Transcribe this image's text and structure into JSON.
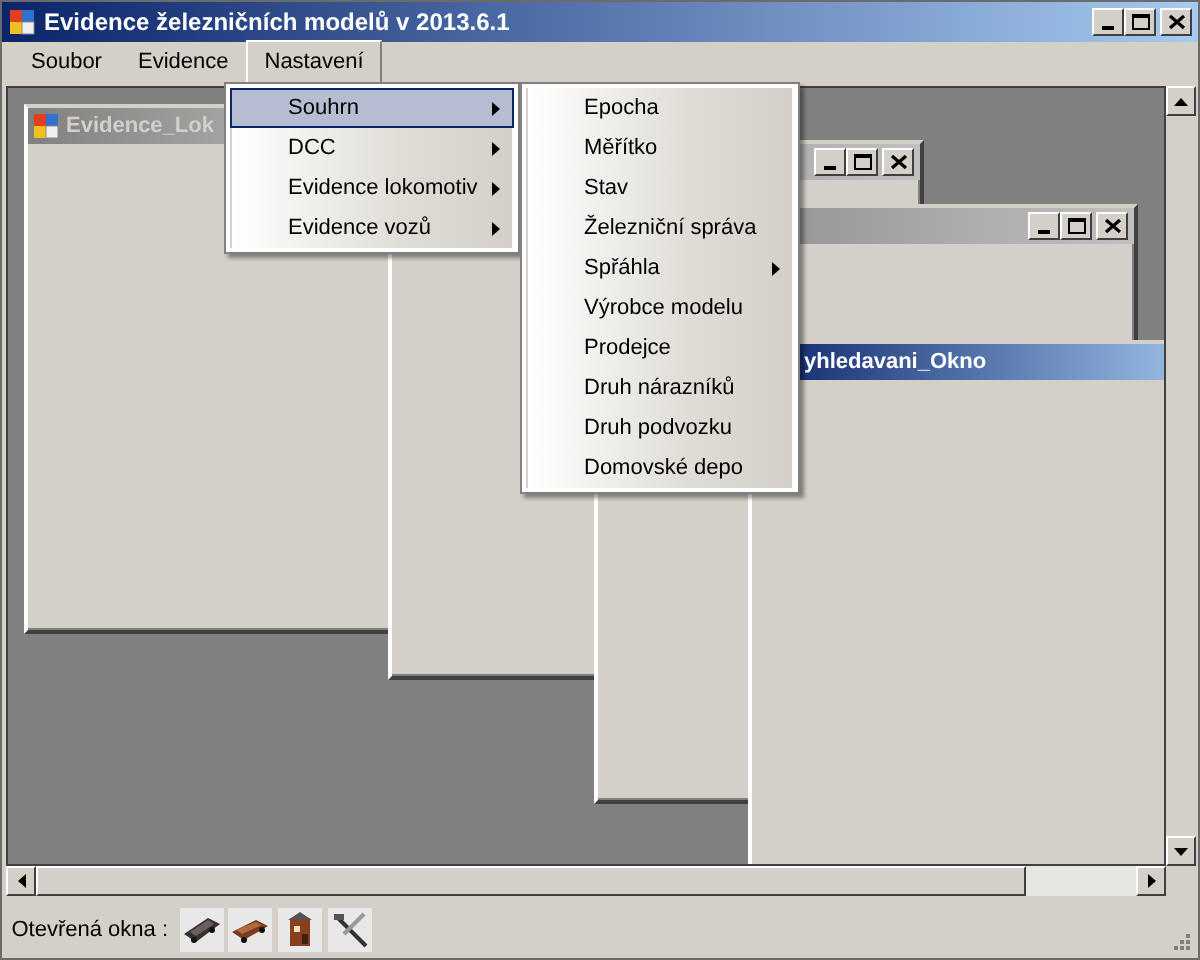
{
  "window": {
    "title": "Evidence železničních modelů v 2013.6.1"
  },
  "menu_bar": [
    {
      "label": "Soubor",
      "selected": false
    },
    {
      "label": "Evidence",
      "selected": false
    },
    {
      "label": "Nastavení",
      "selected": true
    }
  ],
  "dropdown": [
    {
      "label": "Souhrn",
      "has_submenu": true,
      "selected": true
    },
    {
      "label": "DCC",
      "has_submenu": true,
      "selected": false
    },
    {
      "label": "Evidence lokomotiv",
      "has_submenu": true,
      "selected": false
    },
    {
      "label": "Evidence vozů",
      "has_submenu": true,
      "selected": false
    }
  ],
  "submenu": [
    {
      "label": "Epocha",
      "has_submenu": false
    },
    {
      "label": "Měřítko",
      "has_submenu": false
    },
    {
      "label": "Stav",
      "has_submenu": false
    },
    {
      "label": "Železniční správa",
      "has_submenu": false
    },
    {
      "label": "Spřáhla",
      "has_submenu": true
    },
    {
      "label": "Výrobce modelu",
      "has_submenu": false
    },
    {
      "label": "Prodejce",
      "has_submenu": false
    },
    {
      "label": "Druh nárazníků",
      "has_submenu": false
    },
    {
      "label": "Druh podvozku",
      "has_submenu": false
    },
    {
      "label": "Domovské depo",
      "has_submenu": false
    }
  ],
  "child_windows": [
    {
      "title": "Evidence_Lok",
      "active": false,
      "has_icon": true
    },
    {
      "active": false,
      "caption_buttons": true
    },
    {
      "active": false,
      "caption_buttons": true
    },
    {
      "title": "yhledavani_Okno",
      "active": true
    }
  ],
  "status_bar": {
    "label": "Otevřená okna :",
    "open_windows": [
      {
        "kind": "locomotive"
      },
      {
        "kind": "wagon"
      },
      {
        "kind": "building"
      },
      {
        "kind": "tools"
      }
    ]
  }
}
